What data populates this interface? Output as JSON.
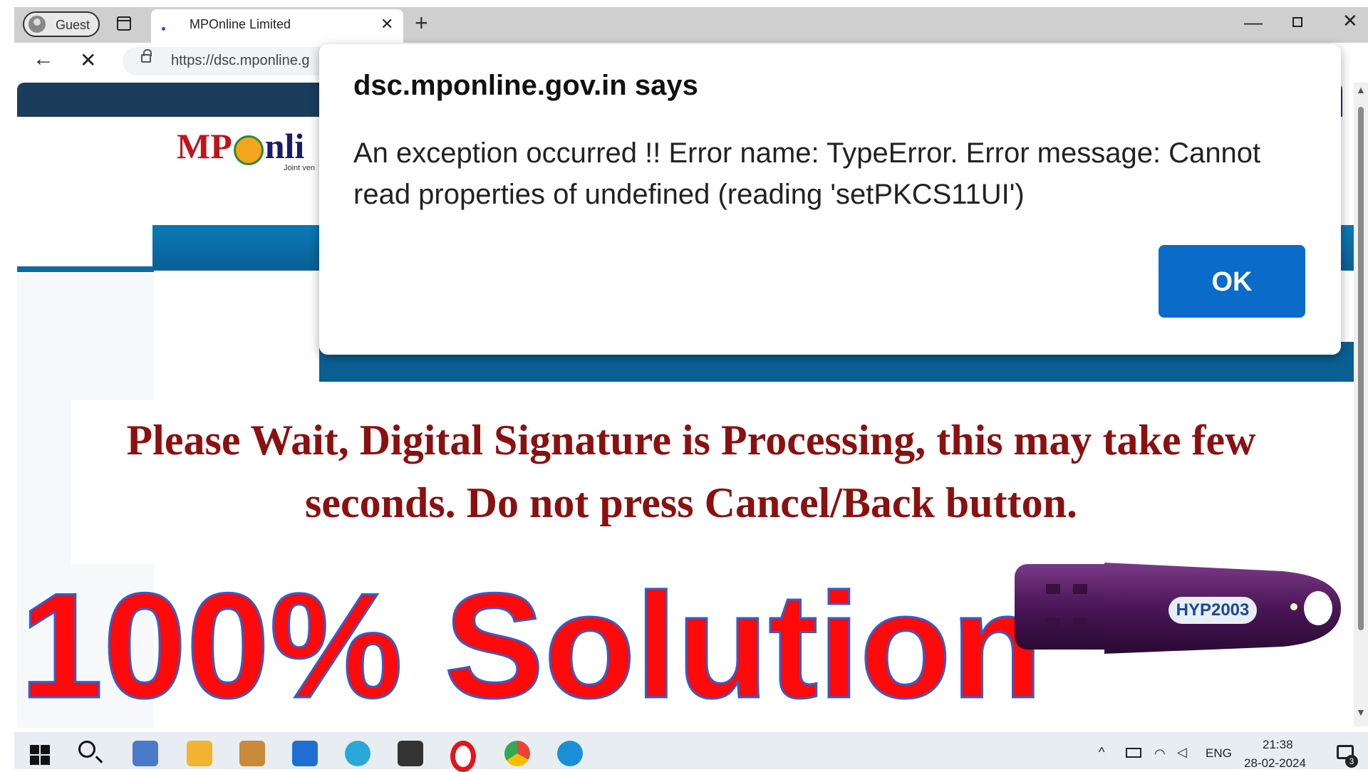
{
  "browser": {
    "profile_label": "Guest",
    "tab_title": "MPOnline Limited",
    "tab_close_glyph": "✕",
    "new_tab_glyph": "+",
    "minimize_glyph": "—",
    "close_glyph": "✕",
    "back_glyph": "←",
    "stop_glyph": "✕",
    "url": "https://dsc.mponline.g"
  },
  "page": {
    "logo_left": "MP",
    "logo_right": "nli",
    "logo_sub": "Joint ven",
    "processing_message": "Please Wait, Digital Signature is Processing, this may take few seconds. Do not press Cancel/Back button."
  },
  "dialog": {
    "title": "dsc.mponline.gov.in says",
    "message": "An exception occurred !! Error name: TypeError. Error message: Cannot read properties of undefined (reading 'setPKCS11UI')",
    "ok_label": "OK"
  },
  "overlay": {
    "headline": "100% Solution",
    "token_label": "HYP2003"
  },
  "taskbar": {
    "language": "ENG",
    "time": "21:38",
    "date": "28-02-2024",
    "notification_count": "3",
    "tray_glyphs": "^"
  },
  "colors": {
    "dialog_button": "#0a6cc8",
    "headline": "#ff0a0a",
    "processing_text": "#8b1010",
    "page_header": "#1a3d5c"
  }
}
